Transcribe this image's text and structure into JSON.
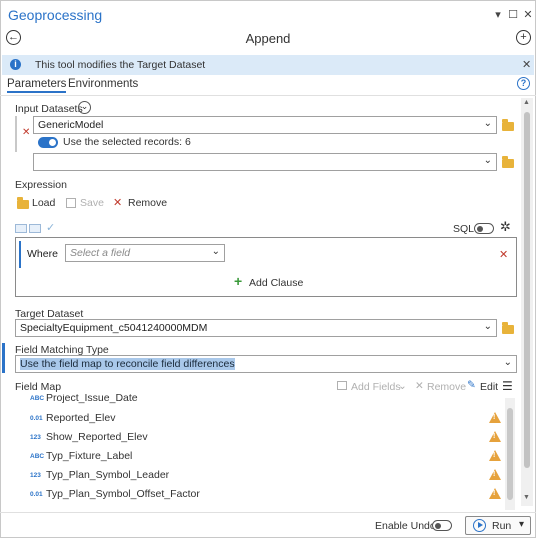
{
  "window": {
    "app_title": "Geoprocessing",
    "pin_glyph": "▾",
    "maximize_glyph": "☐",
    "close_glyph": "✕"
  },
  "toolbar": {
    "tool_name": "Append",
    "back_glyph": "←",
    "add_glyph": "+"
  },
  "banner": {
    "message": "This tool modifies the Target Dataset",
    "info_glyph": "i",
    "close_glyph": "✕"
  },
  "tabs": [
    {
      "label": "Parameters",
      "active": true
    },
    {
      "label": "Environments",
      "active": false
    }
  ],
  "help_glyph": "?",
  "input_datasets": {
    "label": "Input Datasets",
    "expand_glyph": "⌄",
    "remove_glyph": "✕",
    "items": [
      {
        "value": "GenericModel"
      },
      {
        "value": ""
      }
    ],
    "use_selected_label": "Use the selected records: 6",
    "use_selected_on": true
  },
  "expression": {
    "label": "Expression",
    "load_label": "Load",
    "save_label": "Save",
    "remove_label": "Remove",
    "remove_glyph": "✕",
    "sql_label": "SQL",
    "sql_on": false,
    "check_glyph": "✓",
    "settings_glyph": "✲",
    "where_label": "Where",
    "field_placeholder": "Select a field",
    "clause_remove_glyph": "✕",
    "add_clause_label": "Add Clause",
    "add_clause_glyph": "+"
  },
  "target_dataset": {
    "label": "Target Dataset",
    "value": "SpecialtyEquipment_c5041240000MDM"
  },
  "field_matching": {
    "label": "Field Matching Type",
    "value": "Use the field map to reconcile field differences"
  },
  "field_map": {
    "label": "Field Map",
    "add_fields_label": "Add Fields",
    "remove_label": "Remove",
    "edit_label": "Edit",
    "menu_glyph": "☰",
    "rows": [
      {
        "type": "ABC",
        "name": "Project_Issue_Date",
        "warning": false
      },
      {
        "type": "0.01",
        "name": "Reported_Elev",
        "warning": true
      },
      {
        "type": "123",
        "name": "Show_Reported_Elev",
        "warning": true
      },
      {
        "type": "ABC",
        "name": "Typ_Fixture_Label",
        "warning": true
      },
      {
        "type": "123",
        "name": "Typ_Plan_Symbol_Leader",
        "warning": true
      },
      {
        "type": "0.01",
        "name": "Typ_Plan_Symbol_Offset_Factor",
        "warning": true
      }
    ]
  },
  "footer": {
    "enable_undo_label": "Enable Undo",
    "enable_undo_on": false,
    "run_label": "Run",
    "run_menu_glyph": "▾"
  },
  "colors": {
    "accent": "#2b73c8",
    "warning": "#e6a23c",
    "remove_red": "#c0392b",
    "add_green": "#3a9a3a",
    "folder": "#e8b33a"
  }
}
